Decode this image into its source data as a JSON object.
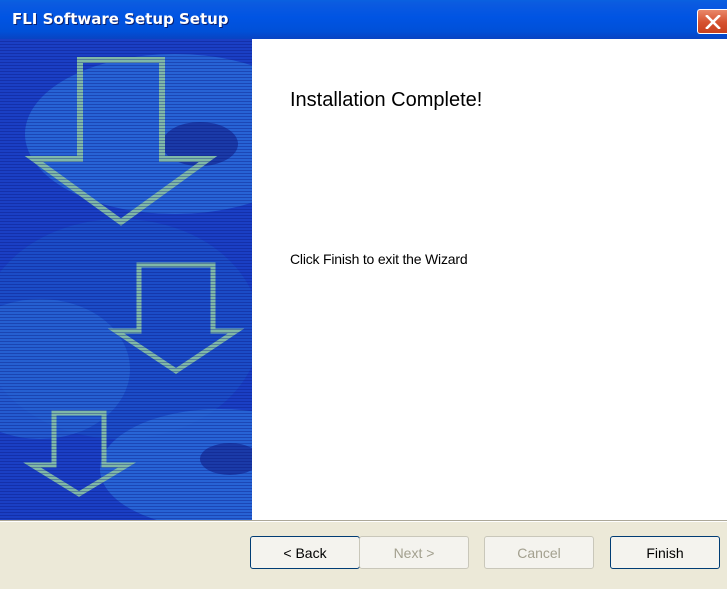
{
  "window": {
    "title": "FLI Software Setup Setup"
  },
  "content": {
    "heading": "Installation Complete!",
    "message": "Click Finish to exit the Wizard"
  },
  "buttons": {
    "back": "< Back",
    "next": "Next >",
    "cancel": "Cancel",
    "finish": "Finish"
  },
  "states": {
    "next_enabled": false,
    "cancel_enabled": false
  },
  "colors": {
    "titlebar": "#0054e3",
    "banner": "#1638c0",
    "banner_arrows": "#7fb8a8",
    "dialog_background": "#ece9d8"
  },
  "icons": {
    "close": "close-icon",
    "banner_arrows": "down-arrow-icon"
  }
}
